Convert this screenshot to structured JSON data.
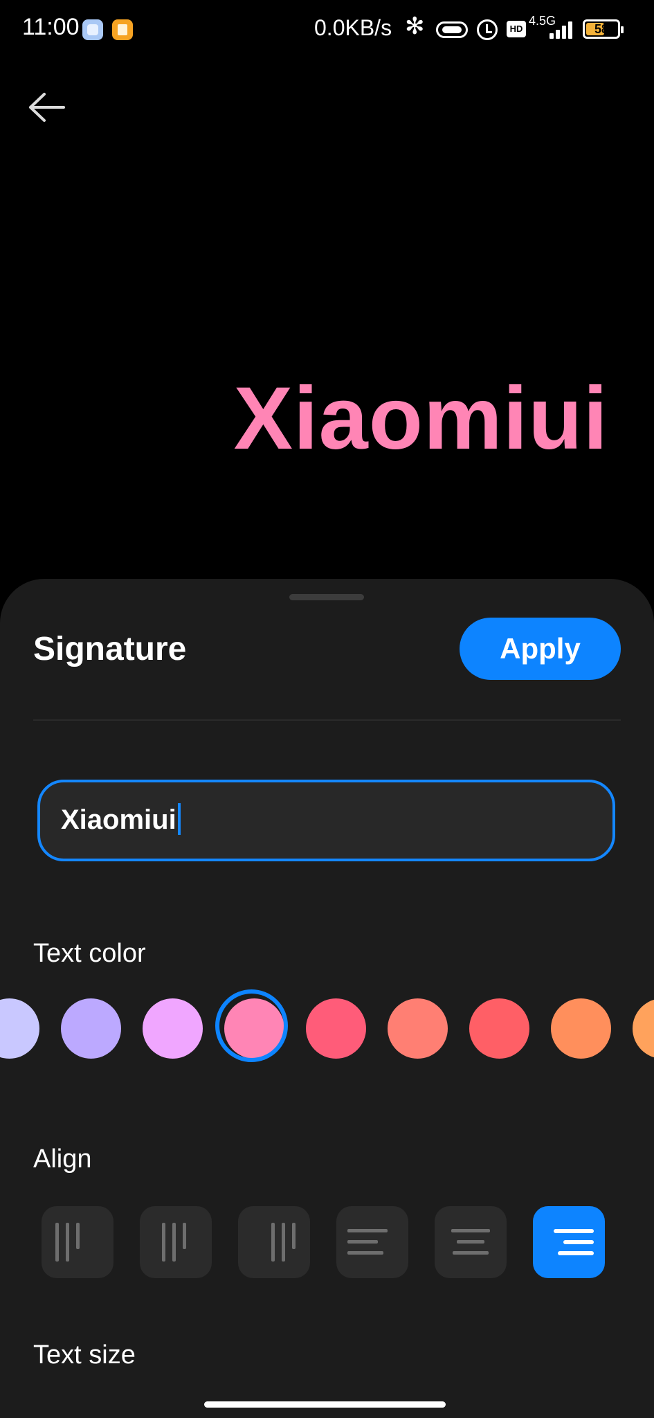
{
  "status_bar": {
    "time": "11:00",
    "network_speed": "0.0KB/s",
    "network_type": "4.5G",
    "hd_label": "HD",
    "battery_percent": "58",
    "battery_level": 0.58
  },
  "preview": {
    "text": "Xiaomiui",
    "color": "#ff85b5"
  },
  "sheet": {
    "title": "Signature",
    "apply_label": "Apply",
    "input": {
      "value": "Xiaomiui"
    },
    "text_color_label": "Text color",
    "colors": [
      {
        "hex": "#c9c8ff",
        "selected": false
      },
      {
        "hex": "#bca9ff",
        "selected": false
      },
      {
        "hex": "#f0a6ff",
        "selected": false
      },
      {
        "hex": "#ff85b5",
        "selected": true
      },
      {
        "hex": "#ff5c79",
        "selected": false
      },
      {
        "hex": "#ff7f73",
        "selected": false
      },
      {
        "hex": "#ff5f66",
        "selected": false
      },
      {
        "hex": "#ff8f5c",
        "selected": false
      },
      {
        "hex": "#ffa25c",
        "selected": false
      }
    ],
    "align_label": "Align",
    "align_options": [
      {
        "name": "vertical-top",
        "active": false
      },
      {
        "name": "vertical-middle",
        "active": false
      },
      {
        "name": "vertical-bottom",
        "active": false
      },
      {
        "name": "horizontal-left",
        "active": false
      },
      {
        "name": "horizontal-center",
        "active": false
      },
      {
        "name": "horizontal-right",
        "active": true
      }
    ],
    "text_size_label": "Text size"
  },
  "accent_color": "#0d84ff"
}
